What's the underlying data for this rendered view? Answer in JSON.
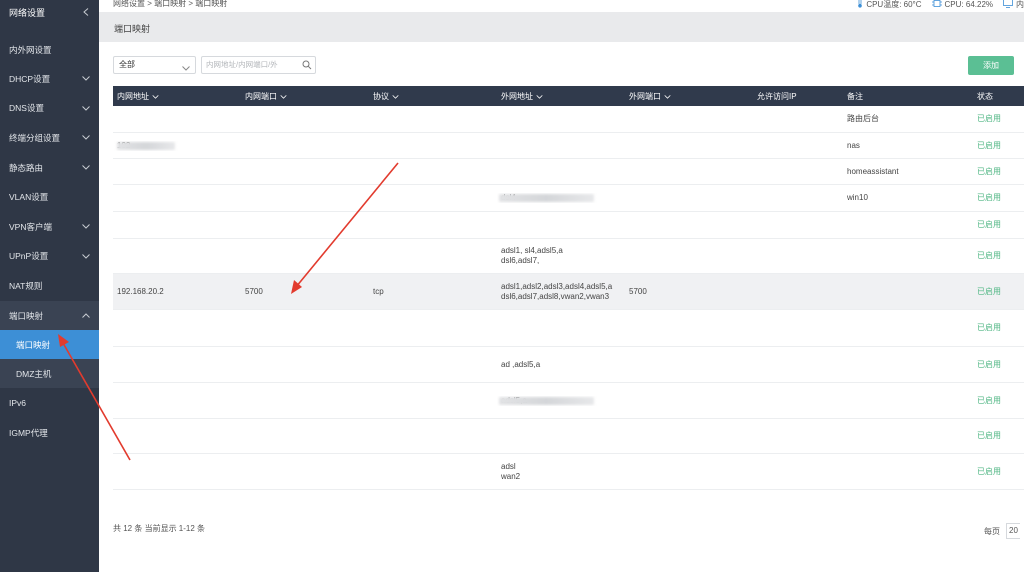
{
  "sidebar": {
    "header": "网络设置",
    "items": [
      {
        "label": "内外网设置"
      },
      {
        "label": "DHCP设置"
      },
      {
        "label": "DNS设置"
      },
      {
        "label": "终端分组设置"
      },
      {
        "label": "静态路由"
      },
      {
        "label": "VLAN设置"
      },
      {
        "label": "VPN客户端"
      },
      {
        "label": "UPnP设置"
      },
      {
        "label": "NAT规则"
      },
      {
        "label": "端口映射"
      },
      {
        "label": "端口映射"
      },
      {
        "label": "DMZ主机"
      },
      {
        "label": "IPv6"
      },
      {
        "label": "IGMP代理"
      }
    ]
  },
  "topbar": {
    "breadcrumb": "网络设置 > 端口映射 > 端口映射",
    "cpu_temp": "CPU温度: 60°C",
    "cpu_usage": "CPU: 64.22%",
    "extra": "内"
  },
  "page": {
    "title": "端口映射"
  },
  "filter": {
    "selected": "全部",
    "search_placeholder": "内网地址/内网端口/外"
  },
  "toolbar": {
    "add_label": "添加"
  },
  "table": {
    "headers": [
      "内网地址",
      "内网端口",
      "协议",
      "外网地址",
      "外网端口",
      "允许访问IP",
      "备注",
      "状态"
    ],
    "rows": [
      {
        "ip": "",
        "port": "",
        "proto": "",
        "wan": "",
        "wport": "",
        "allow": "",
        "note": "路由后台",
        "status": "已启用"
      },
      {
        "ip": "192",
        "port": "",
        "proto": "",
        "wan": "",
        "wport": "",
        "allow": "",
        "note": "nas",
        "status": "已启用"
      },
      {
        "ip": "",
        "port": "",
        "proto": "",
        "wan": "",
        "wport": "",
        "allow": "",
        "note": "homeassistant",
        "status": "已启用"
      },
      {
        "ip": "",
        "port": "",
        "proto": "",
        "wan": "dsl4",
        "wport": "",
        "allow": "",
        "note": "win10",
        "status": "已启用"
      },
      {
        "ip": "",
        "port": "",
        "proto": "",
        "wan": "",
        "wport": "",
        "allow": "",
        "note": "",
        "status": "已启用"
      },
      {
        "ip": "",
        "port": "",
        "proto": "",
        "wan": "adsl1, sl4,adsl5,a",
        "wan2": "dsl6,adsl7,",
        "wport": "",
        "allow": "",
        "note": "",
        "status": "已启用"
      },
      {
        "ip": "192.168.20.2",
        "port": "5700",
        "proto": "tcp",
        "wan": "adsl1,adsl2,adsl3,adsl4,adsl5,a",
        "wan2": "dsl6,adsl7,adsl8,vwan2,vwan3",
        "wport": "5700",
        "allow": "",
        "note": "",
        "status": "已启用"
      },
      {
        "ip": "",
        "port": "",
        "proto": "",
        "wan": "",
        "wport": "",
        "allow": "",
        "note": "",
        "status": "已启用"
      },
      {
        "ip": "",
        "port": "",
        "proto": "",
        "wan": "ad ,adsl5,a",
        "wport": "",
        "allow": "",
        "note": "",
        "status": "已启用"
      },
      {
        "ip": "",
        "port": "",
        "proto": "",
        "wan": "adsl5,a",
        "wport": "",
        "allow": "",
        "note": "",
        "status": "已启用"
      },
      {
        "ip": "",
        "port": "",
        "proto": "",
        "wan": "",
        "wport": "",
        "allow": "",
        "note": "",
        "status": "已启用"
      },
      {
        "ip": "",
        "port": "",
        "proto": "",
        "wan": "adsl",
        "wan2": "wan2",
        "wport": "",
        "allow": "",
        "note": "",
        "status": "已启用"
      }
    ]
  },
  "footer": {
    "summary": "共 12 条 当前显示 1-12 条",
    "per_page_label": "每页",
    "per_page_value": "20"
  },
  "colors": {
    "sidebar_bg": "#2f3746",
    "active_item": "#3d8fd6",
    "table_header": "#303a4c",
    "add_button": "#5bbf94",
    "status_enabled": "#4fb683",
    "annotation_arrow": "#e23b2e"
  }
}
